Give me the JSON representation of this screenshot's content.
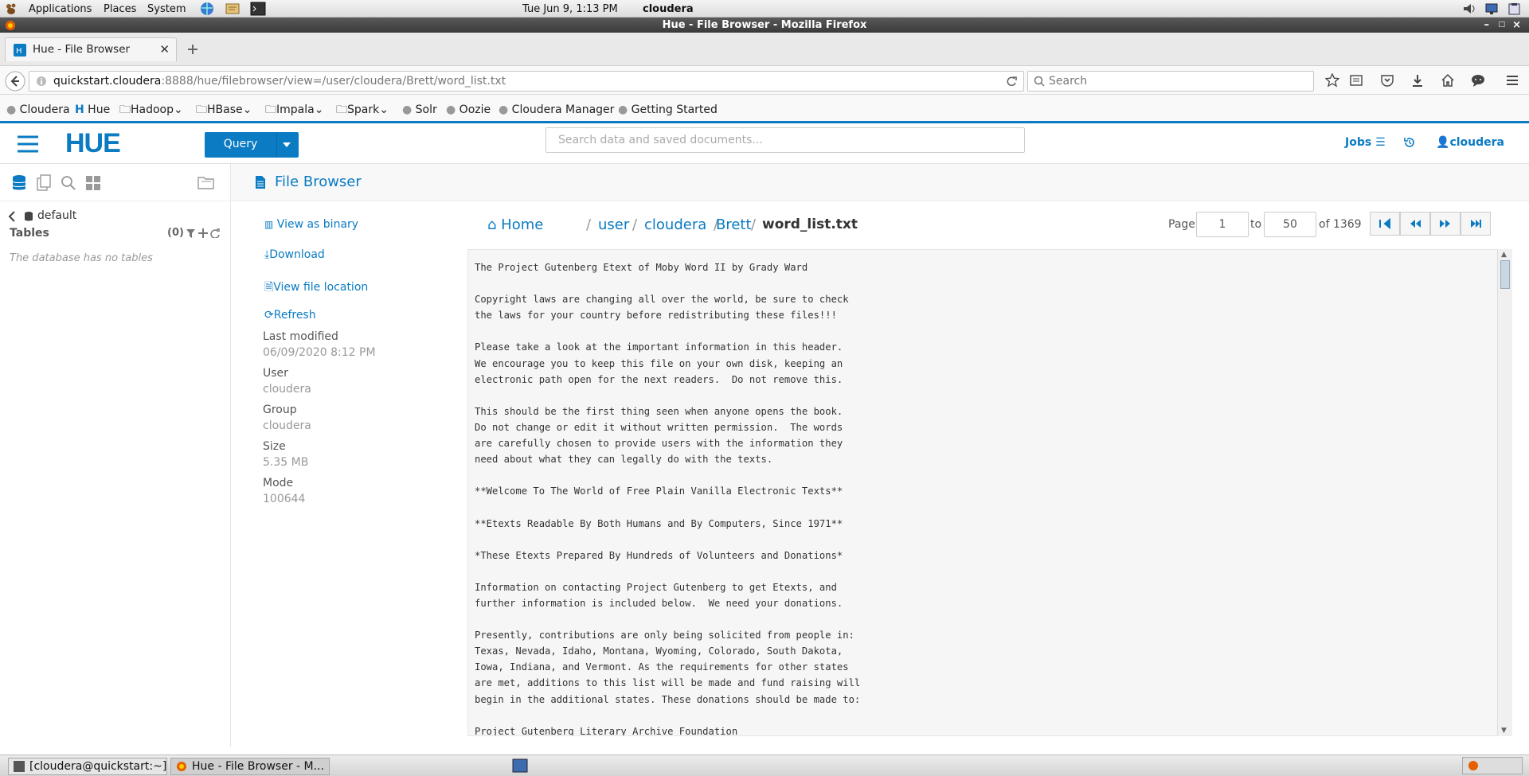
{
  "gnome_panel": {
    "menus": [
      "Applications",
      "Places",
      "System"
    ],
    "clock": "Tue Jun  9,  1:13 PM",
    "user": "cloudera"
  },
  "window": {
    "title": "Hue - File Browser - Mozilla Firefox"
  },
  "browser": {
    "tab_label": "Hue - File Browser",
    "url_host": "quickstart.cloudera",
    "url_rest": ":8888/hue/filebrowser/view=/user/cloudera/Brett/word_list.txt",
    "search_placeholder": "Search",
    "bookmarks": [
      "Cloudera",
      "Hue",
      "Hadoop",
      "HBase",
      "Impala",
      "Spark",
      "Solr",
      "Oozie",
      "Cloudera Manager",
      "Getting Started"
    ]
  },
  "hue": {
    "logo": "HUE",
    "query_label": "Query",
    "search_placeholder": "Search data and saved documents...",
    "jobs_label": "Jobs",
    "user": "cloudera"
  },
  "left_panel": {
    "database": "default",
    "tables_label": "Tables",
    "tables_count": "(0)",
    "empty_message": "The database has no tables"
  },
  "file_browser": {
    "title": "File Browser",
    "actions": {
      "view_binary": "View as binary",
      "download": "Download",
      "view_location": "View file location",
      "refresh": "Refresh"
    },
    "meta": {
      "last_modified_label": "Last modified",
      "last_modified": "06/09/2020 8:12 PM",
      "user_label": "User",
      "user": "cloudera",
      "group_label": "Group",
      "group": "cloudera",
      "size_label": "Size",
      "size": "5.35 MB",
      "mode_label": "Mode",
      "mode": "100644"
    },
    "breadcrumb": {
      "home": "Home",
      "items": [
        "user",
        "cloudera",
        "Brett"
      ],
      "current": "word_list.txt"
    },
    "pager": {
      "page_label": "Page",
      "from": "1",
      "to_label": "to",
      "to": "50",
      "of_label": "of 1369"
    },
    "content": "The Project Gutenberg Etext of Moby Word II by Grady Ward\n\nCopyright laws are changing all over the world, be sure to check\nthe laws for your country before redistributing these files!!!\n\nPlease take a look at the important information in this header.\nWe encourage you to keep this file on your own disk, keeping an\nelectronic path open for the next readers.  Do not remove this.\n\nThis should be the first thing seen when anyone opens the book.\nDo not change or edit it without written permission.  The words\nare carefully chosen to provide users with the information they\nneed about what they can legally do with the texts.\n\n**Welcome To The World of Free Plain Vanilla Electronic Texts**\n\n**Etexts Readable By Both Humans and By Computers, Since 1971**\n\n*These Etexts Prepared By Hundreds of Volunteers and Donations*\n\nInformation on contacting Project Gutenberg to get Etexts, and\nfurther information is included below.  We need your donations.\n\nPresently, contributions are only being solicited from people in:\nTexas, Nevada, Idaho, Montana, Wyoming, Colorado, South Dakota,\nIowa, Indiana, and Vermont. As the requirements for other states\nare met, additions to this list will be made and fund raising will\nbegin in the additional states. These donations should be made to:\n\nProject Gutenberg Literary Archive Foundation"
  },
  "taskbar": {
    "items": [
      "[cloudera@quickstart:~]",
      "Hue - File Browser - M..."
    ]
  },
  "colors": {
    "accent": "#0b7bc3",
    "title_bar": "#3a3a3a"
  }
}
